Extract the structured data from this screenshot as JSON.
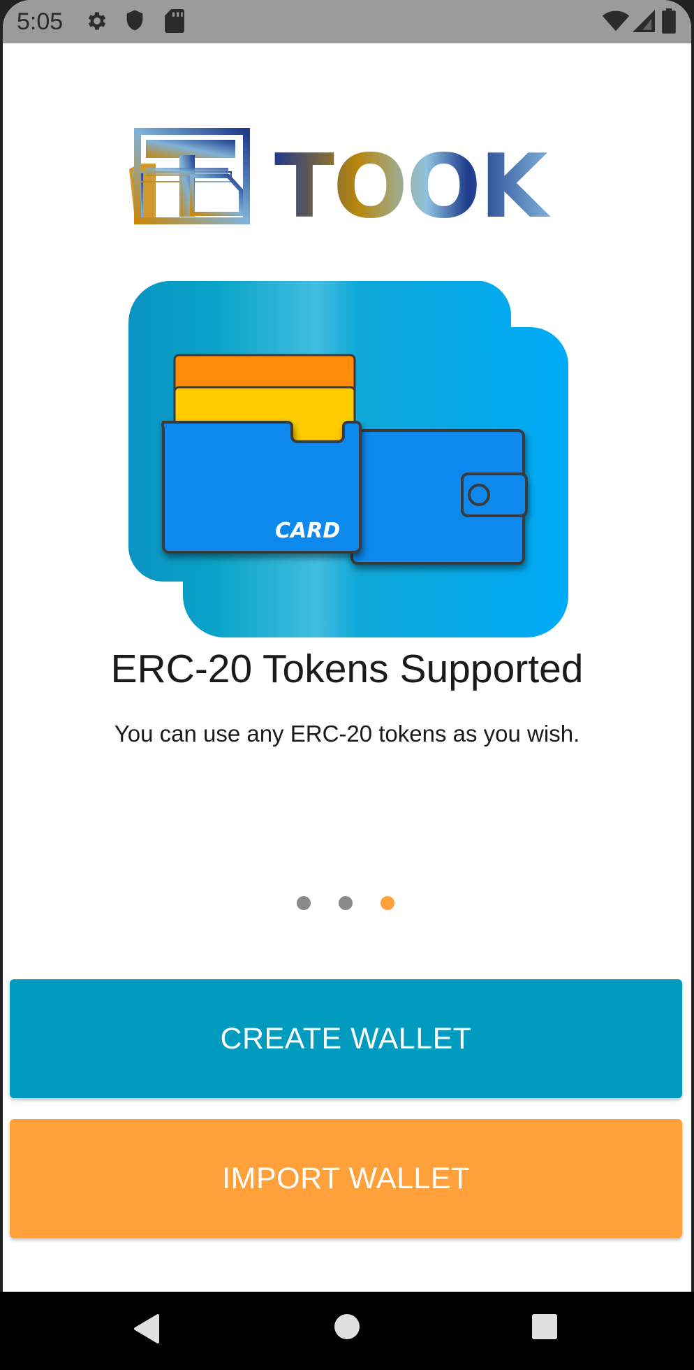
{
  "status_bar": {
    "time": "5:05",
    "left_icons": [
      "settings-icon",
      "shield-icon",
      "sd-card-icon"
    ],
    "right_icons": [
      "wifi-icon",
      "cellular-icon",
      "battery-icon"
    ]
  },
  "logo": {
    "text": "TOOK"
  },
  "hero": {
    "card_label": "CARD"
  },
  "onboarding": {
    "title": "ERC-20 Tokens Supported",
    "subtitle": "You can use any ERC-20 tokens as you wish.",
    "page_count": 3,
    "active_page": 3
  },
  "buttons": {
    "create_label": "CREATE WALLET",
    "import_label": "IMPORT WALLET"
  },
  "colors": {
    "create_button": "#009bbf",
    "import_button": "#ffa03a",
    "dot_inactive": "#8a8a8a",
    "dot_active": "#ffa03a"
  },
  "nav_bar": {
    "icons": [
      "back-icon",
      "home-icon",
      "recents-icon"
    ]
  }
}
